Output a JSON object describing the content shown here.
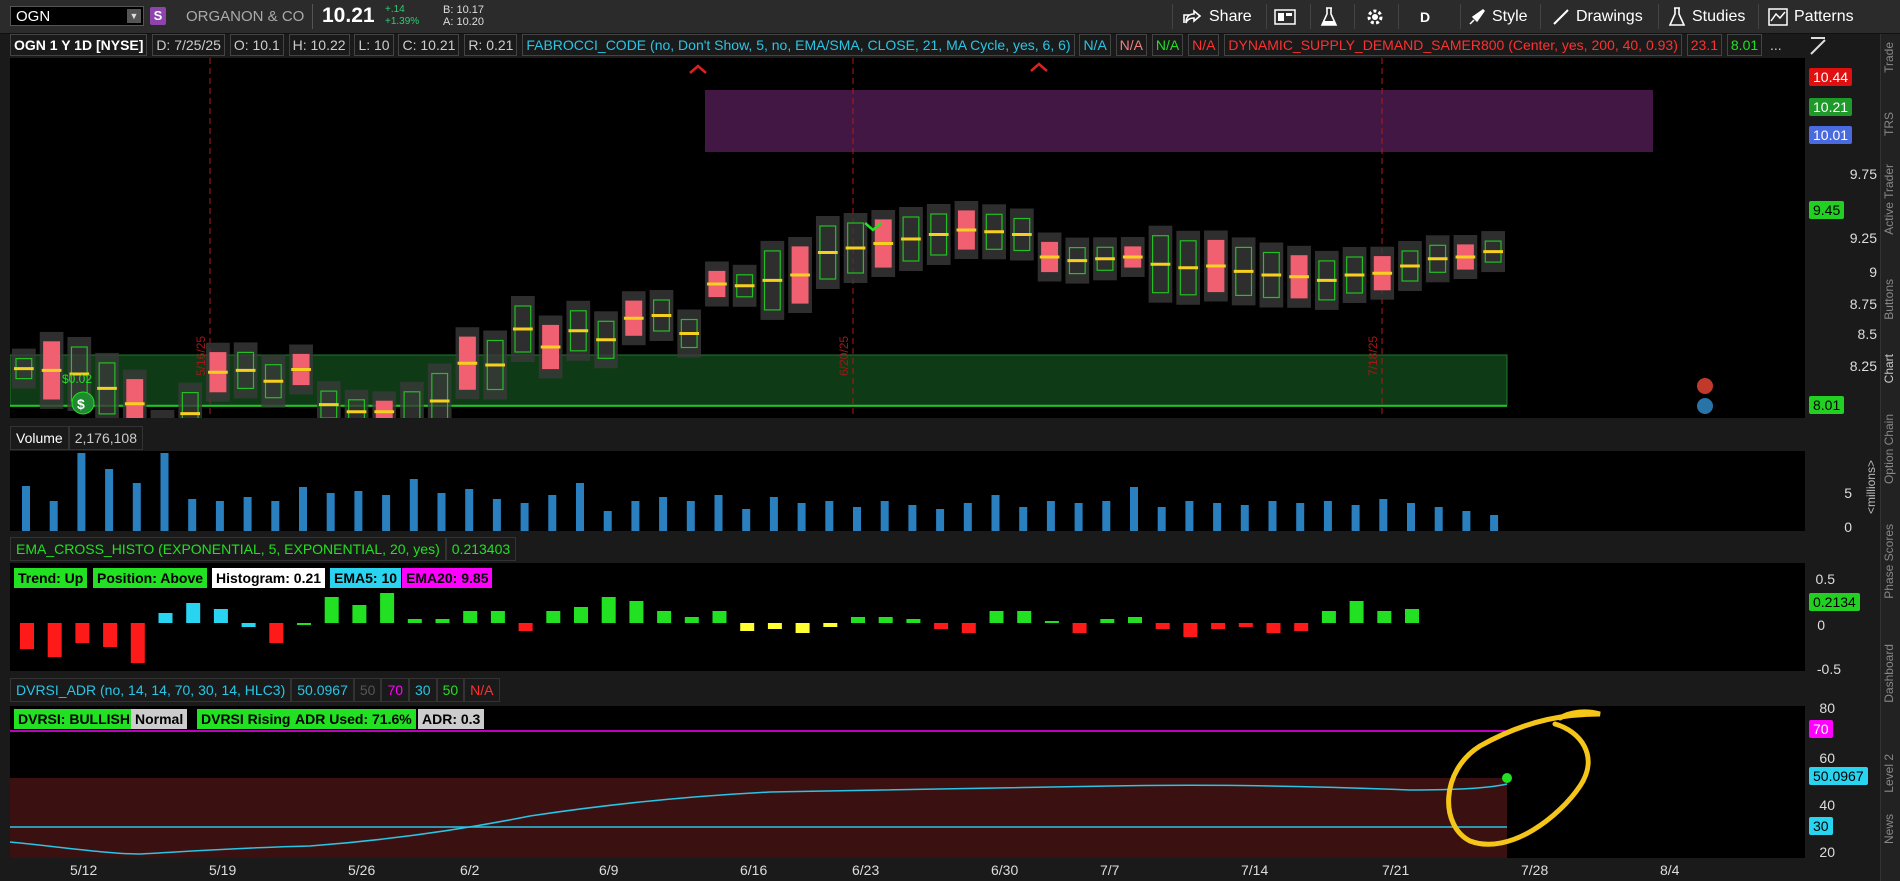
{
  "header": {
    "symbol": "OGN",
    "s_badge": "S",
    "company": "ORGANON & CO",
    "last": "10.21",
    "change_abs": "+.14",
    "change_pct": "+1.39%",
    "bid": "B: 10.17",
    "ask": "A: 10.20",
    "share": "Share",
    "period": "D",
    "style": "Style",
    "drawings": "Drawings",
    "studies": "Studies",
    "patterns": "Patterns"
  },
  "upper": {
    "title": "OGN 1 Y 1D [NYSE]",
    "date": "D: 7/25/25",
    "open": "O: 10.1",
    "high": "H: 10.22",
    "low": "L: 10",
    "close": "C: 10.21",
    "range": "R: 0.21",
    "study1": "FABROCCI_CODE (no, Don't Show, 5, no, EMA/SMA, CLOSE, 21, MA Cycle, yes, 6, 6)",
    "na1": "N/A",
    "na2": "N/A",
    "na3": "N/A",
    "na4": "N/A",
    "study2": "DYNAMIC_SUPPLY_DEMAND_SAMER800 (Center, yes, 200, 40, 0.93)",
    "val1": "23.1",
    "val2": "8.01",
    "more": "...",
    "dividend": "$0.02",
    "dates": [
      "5/16/25",
      "6/20/25",
      "7/18/25"
    ],
    "axis": [
      "9.75",
      "9.25",
      "9",
      "8.75",
      "8.5",
      "8.25"
    ],
    "tag_high": "10.44",
    "tag_last": "10.21",
    "tag_blue": "10.01",
    "tag_green": "9.45",
    "tag_low": "8.01"
  },
  "volume": {
    "label": "Volume",
    "value": "2,176,108",
    "axis_5": "5",
    "axis_0": "0",
    "units": "<millions>"
  },
  "ema": {
    "title": "EMA_CROSS_HISTO (EXPONENTIAL, 5, EXPONENTIAL, 20, yes)",
    "value": "0.213403",
    "trend": "Trend: Up",
    "position": "Position: Above",
    "histogram": "Histogram: 0.21",
    "ema5": "EMA5: 10",
    "ema20": "EMA20: 9.85",
    "axis_top": "0.5",
    "axis_zero": "0",
    "axis_bottom": "-0.5",
    "tag": "0.2134"
  },
  "dvrsi": {
    "title": "DVRSI_ADR (no, 14, 14, 70, 30, 14, HLC3)",
    "value": "50.0967",
    "p50": "50",
    "p70": "70",
    "p30": "30",
    "p50b": "50",
    "na": "N/A",
    "bull": "DVRSI: BULLISH",
    "normal": "Normal",
    "rising": "DVRSI Rising",
    "adr_used": "ADR Used: 71.6%",
    "adr": "ADR: 0.3",
    "axis": [
      "80",
      "60",
      "40",
      "20"
    ],
    "tag70": "70",
    "tag_val": "50.0967",
    "tag30": "30"
  },
  "xaxis": [
    "5/12",
    "5/19",
    "5/26",
    "6/2",
    "6/9",
    "6/16",
    "6/23",
    "6/30",
    "7/7",
    "7/14",
    "7/21",
    "7/28",
    "8/4"
  ],
  "sidebar": [
    "Trade",
    "TRS",
    "Active Trader",
    "Buttons",
    "Chart",
    "Option Chain",
    "Phase Scores",
    "Dashboard",
    "Level 2",
    "News"
  ]
}
